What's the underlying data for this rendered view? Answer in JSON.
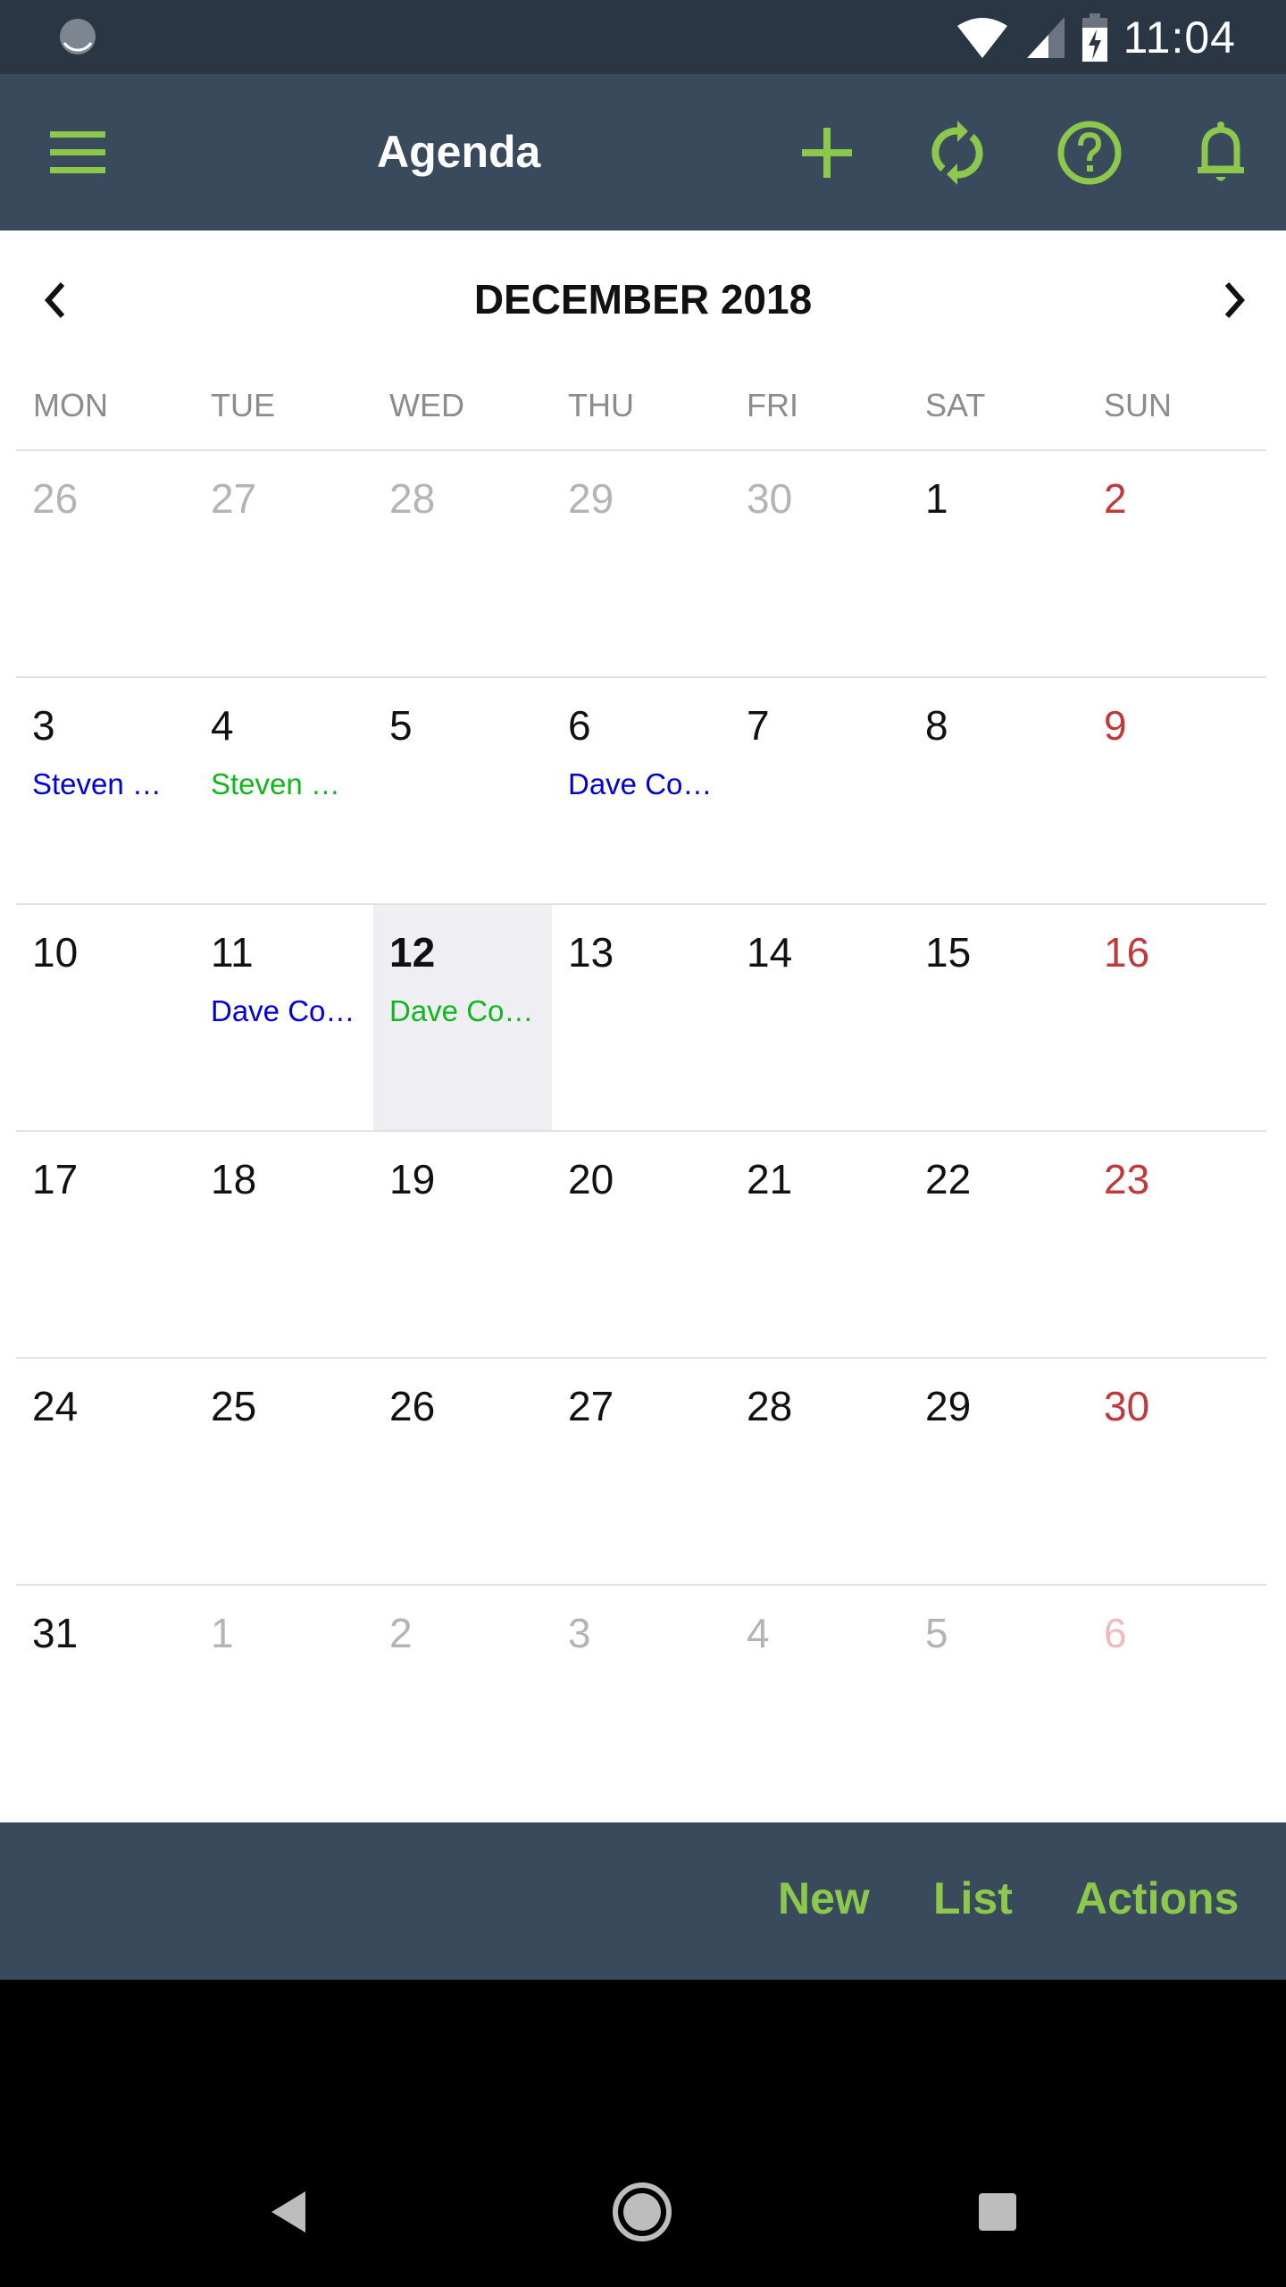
{
  "status_bar": {
    "time": "11:04",
    "icons": [
      "sync-status-icon",
      "wifi-icon",
      "cellular-signal-icon",
      "battery-charging-icon"
    ]
  },
  "app_bar": {
    "title": "Agenda",
    "menu_icon": "hamburger-menu-icon",
    "actions": [
      {
        "name": "add",
        "icon": "plus-icon"
      },
      {
        "name": "refresh",
        "icon": "sync-icon"
      },
      {
        "name": "help",
        "icon": "help-circle-icon"
      },
      {
        "name": "notifications",
        "icon": "bell-icon"
      }
    ],
    "accent_color": "#8cc84b",
    "background_color": "#394a5c"
  },
  "calendar": {
    "month_label": "DECEMBER 2018",
    "prev_icon": "chevron-left-icon",
    "next_icon": "chevron-right-icon",
    "weekdays": [
      "MON",
      "TUE",
      "WED",
      "THU",
      "FRI",
      "SAT",
      "SUN"
    ],
    "today": 12,
    "colors": {
      "sunday": "#c0393b",
      "event_blue": "#0000d8",
      "event_green": "#0fb81a",
      "today_bg": "#efeff3"
    },
    "weeks": [
      [
        {
          "day": "26",
          "other": true
        },
        {
          "day": "27",
          "other": true
        },
        {
          "day": "28",
          "other": true
        },
        {
          "day": "29",
          "other": true
        },
        {
          "day": "30",
          "other": true
        },
        {
          "day": "1"
        },
        {
          "day": "2"
        }
      ],
      [
        {
          "day": "3",
          "event": "Steven …",
          "event_color": "blue"
        },
        {
          "day": "4",
          "event": "Steven …",
          "event_color": "green"
        },
        {
          "day": "5"
        },
        {
          "day": "6",
          "event": "Dave Co…",
          "event_color": "blue"
        },
        {
          "day": "7"
        },
        {
          "day": "8"
        },
        {
          "day": "9"
        }
      ],
      [
        {
          "day": "10"
        },
        {
          "day": "11",
          "event": "Dave Co…",
          "event_color": "blue"
        },
        {
          "day": "12",
          "event": "Dave Co…",
          "event_color": "green",
          "today": true
        },
        {
          "day": "13"
        },
        {
          "day": "14"
        },
        {
          "day": "15"
        },
        {
          "day": "16"
        }
      ],
      [
        {
          "day": "17"
        },
        {
          "day": "18"
        },
        {
          "day": "19"
        },
        {
          "day": "20"
        },
        {
          "day": "21"
        },
        {
          "day": "22"
        },
        {
          "day": "23"
        }
      ],
      [
        {
          "day": "24"
        },
        {
          "day": "25"
        },
        {
          "day": "26"
        },
        {
          "day": "27"
        },
        {
          "day": "28"
        },
        {
          "day": "29"
        },
        {
          "day": "30"
        }
      ],
      [
        {
          "day": "31"
        },
        {
          "day": "1",
          "other": true
        },
        {
          "day": "2",
          "other": true
        },
        {
          "day": "3",
          "other": true
        },
        {
          "day": "4",
          "other": true
        },
        {
          "day": "5",
          "other": true
        },
        {
          "day": "6",
          "other": true
        }
      ]
    ]
  },
  "bottom_bar": {
    "buttons": [
      "New",
      "List",
      "Actions"
    ]
  },
  "nav_bar": {
    "buttons": [
      "back-icon",
      "home-icon",
      "recents-icon"
    ]
  }
}
